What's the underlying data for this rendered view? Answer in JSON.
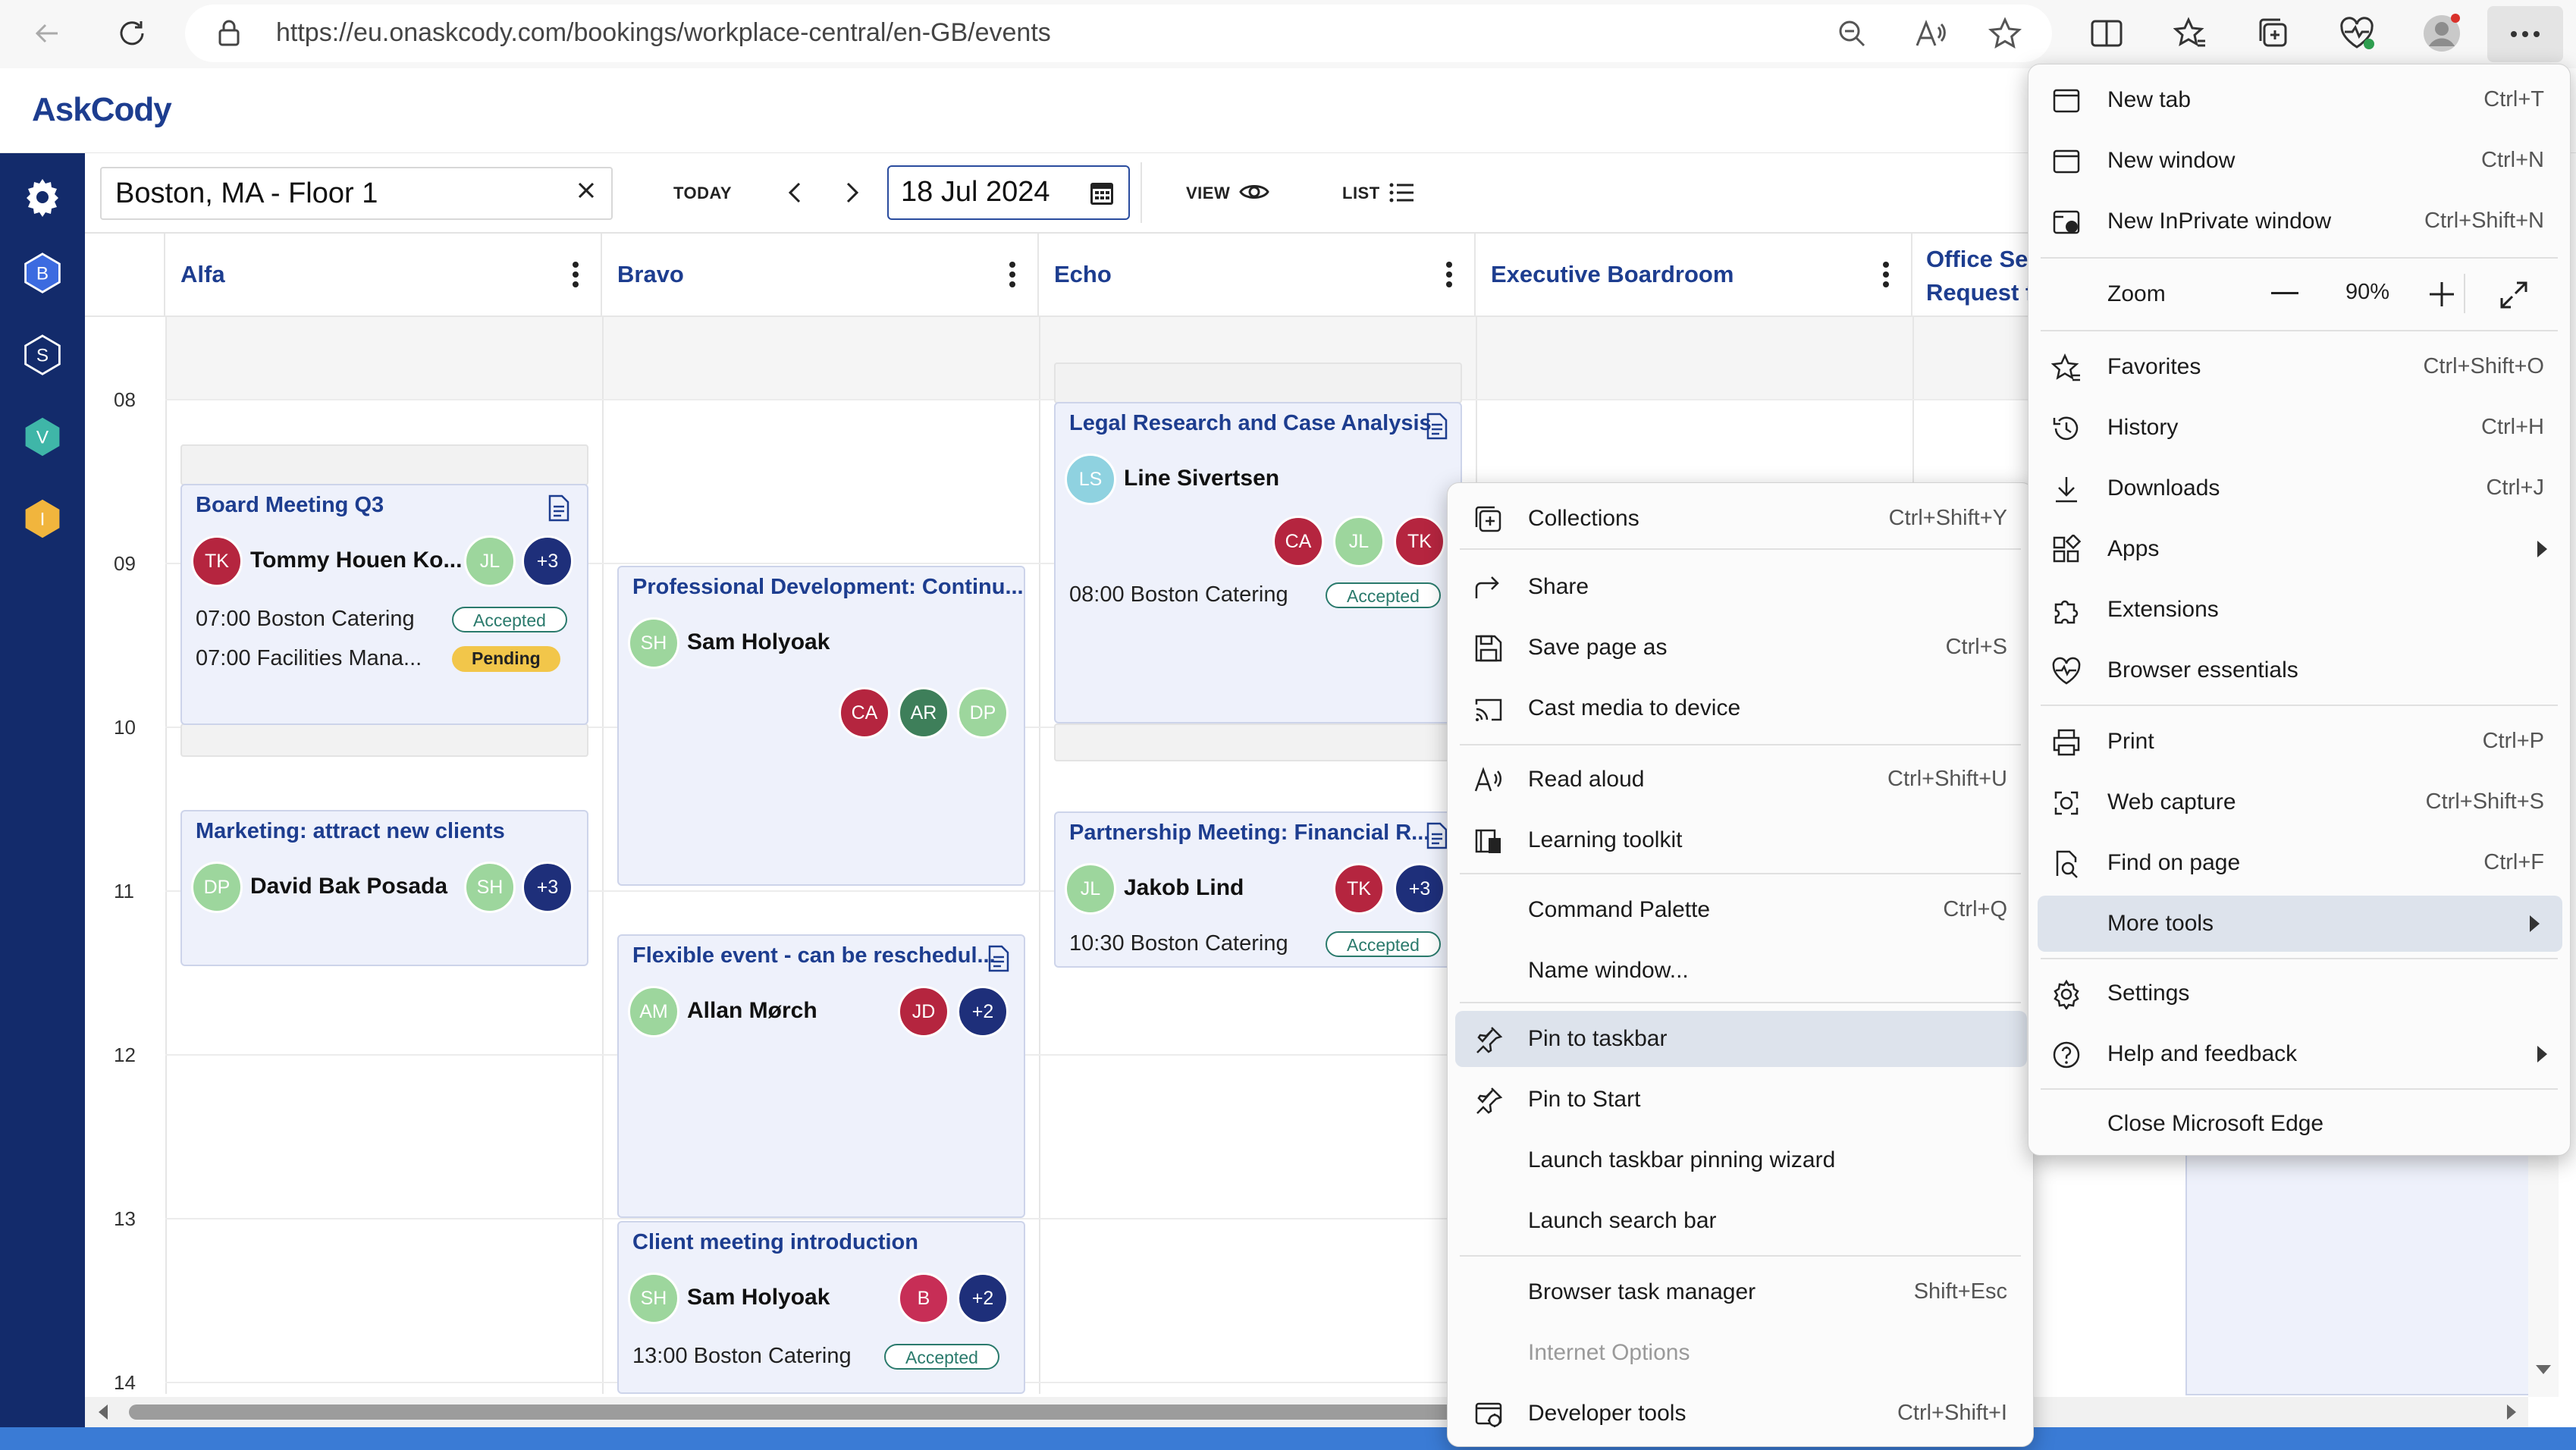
{
  "browser": {
    "url": "https://eu.onaskcody.com/bookings/workplace-central/en-GB/events",
    "toolbar_icons": [
      "back-icon",
      "refresh-icon",
      "lock-icon",
      "zoom-out-icon",
      "read-aloud-icon",
      "favorite-star-icon",
      "split-screen-icon",
      "favorites-icon",
      "collections-icon",
      "browser-essentials-icon",
      "profile-avatar-icon",
      "more-menu-icon"
    ]
  },
  "app": {
    "logo": "AskCody",
    "sidebar": [
      "settings-gear-icon",
      "B",
      "S",
      "V",
      "I"
    ],
    "location": "Boston, MA - Floor 1",
    "today_label": "TODAY",
    "date_value": "18 Jul 2024",
    "view_label": "VIEW",
    "list_label": "LIST"
  },
  "calendar": {
    "columns": [
      "Alfa",
      "Bravo",
      "Echo",
      "Executive Boardroom",
      "Office Ser... Request f..."
    ],
    "column_5_line1": "Office Ser",
    "column_5_line2": "Request f",
    "hours": [
      "08",
      "09",
      "10",
      "11",
      "12",
      "13",
      "14"
    ],
    "events": [
      {
        "title": "Board Meeting Q3",
        "person": "Tommy Houen Ko...",
        "person_initials": "TK",
        "attendees": [
          "JL",
          "+3"
        ],
        "lines": [
          {
            "text": "07:00  Boston Catering",
            "status": "Accepted"
          },
          {
            "text": "07:00  Facilities Mana...",
            "status": "Pending"
          }
        ]
      },
      {
        "title": "Marketing: attract new clients",
        "person": "David Bak Posada",
        "person_initials": "DP",
        "attendees": [
          "SH",
          "+3"
        ]
      },
      {
        "title": "Professional Development: Continu...",
        "person": "Sam Holyoak",
        "person_initials": "SH",
        "attendees": [
          "CA",
          "AR",
          "DP"
        ]
      },
      {
        "title": "Flexible event - can be reschedul...",
        "person": "Allan Mørch",
        "person_initials": "AM",
        "attendees": [
          "JD",
          "+2"
        ]
      },
      {
        "title": "Client meeting introduction",
        "person": "Sam Holyoak",
        "person_initials": "SH",
        "attendees": [
          "B",
          "+2"
        ],
        "lines": [
          {
            "text": "13:00  Boston Catering",
            "status": "Accepted"
          }
        ]
      },
      {
        "title": "Legal Research and Case Analysis",
        "person": "Line Sivertsen",
        "person_initials": "LS",
        "attendees": [
          "CA",
          "JL",
          "TK"
        ],
        "lines": [
          {
            "text": "08:00  Boston Catering",
            "status": "Accepted"
          }
        ]
      },
      {
        "title": "Partnership Meeting: Financial R...",
        "person": "Jakob Lind",
        "person_initials": "JL",
        "attendees": [
          "TK",
          "+3"
        ],
        "lines": [
          {
            "text": "10:30  Boston Catering",
            "status": "Accepted"
          }
        ]
      }
    ]
  },
  "main_menu": {
    "items": [
      {
        "label": "New tab",
        "shortcut": "Ctrl+T"
      },
      {
        "label": "New window",
        "shortcut": "Ctrl+N"
      },
      {
        "label": "New InPrivate window",
        "shortcut": "Ctrl+Shift+N"
      },
      {
        "label": "Zoom",
        "value": "90%"
      },
      {
        "label": "Favorites",
        "shortcut": "Ctrl+Shift+O"
      },
      {
        "label": "History",
        "shortcut": "Ctrl+H"
      },
      {
        "label": "Downloads",
        "shortcut": "Ctrl+J"
      },
      {
        "label": "Apps"
      },
      {
        "label": "Extensions"
      },
      {
        "label": "Browser essentials"
      },
      {
        "label": "Print",
        "shortcut": "Ctrl+P"
      },
      {
        "label": "Web capture",
        "shortcut": "Ctrl+Shift+S"
      },
      {
        "label": "Find on page",
        "shortcut": "Ctrl+F"
      },
      {
        "label": "More tools"
      },
      {
        "label": "Settings"
      },
      {
        "label": "Help and feedback"
      },
      {
        "label": "Close Microsoft Edge"
      }
    ]
  },
  "sub_menu": {
    "items": [
      {
        "label": "Collections",
        "shortcut": "Ctrl+Shift+Y"
      },
      {
        "label": "Share"
      },
      {
        "label": "Save page as",
        "shortcut": "Ctrl+S"
      },
      {
        "label": "Cast media to device"
      },
      {
        "label": "Read aloud",
        "shortcut": "Ctrl+Shift+U"
      },
      {
        "label": "Learning toolkit"
      },
      {
        "label": "Command Palette",
        "shortcut": "Ctrl+Q"
      },
      {
        "label": "Name window..."
      },
      {
        "label": "Pin to taskbar"
      },
      {
        "label": "Pin to Start"
      },
      {
        "label": "Launch taskbar pinning wizard"
      },
      {
        "label": "Launch search bar"
      },
      {
        "label": "Browser task manager",
        "shortcut": "Shift+Esc"
      },
      {
        "label": "Internet Options"
      },
      {
        "label": "Developer tools",
        "shortcut": "Ctrl+Shift+I"
      }
    ]
  },
  "colors": {
    "brand": "#1d3d8f",
    "sidebar": "#132b6b",
    "card_bg": "#eef1fb",
    "accepted": "#2a7a6c",
    "pending": "#f2c64a",
    "menu_selected": "#dde3ec"
  }
}
